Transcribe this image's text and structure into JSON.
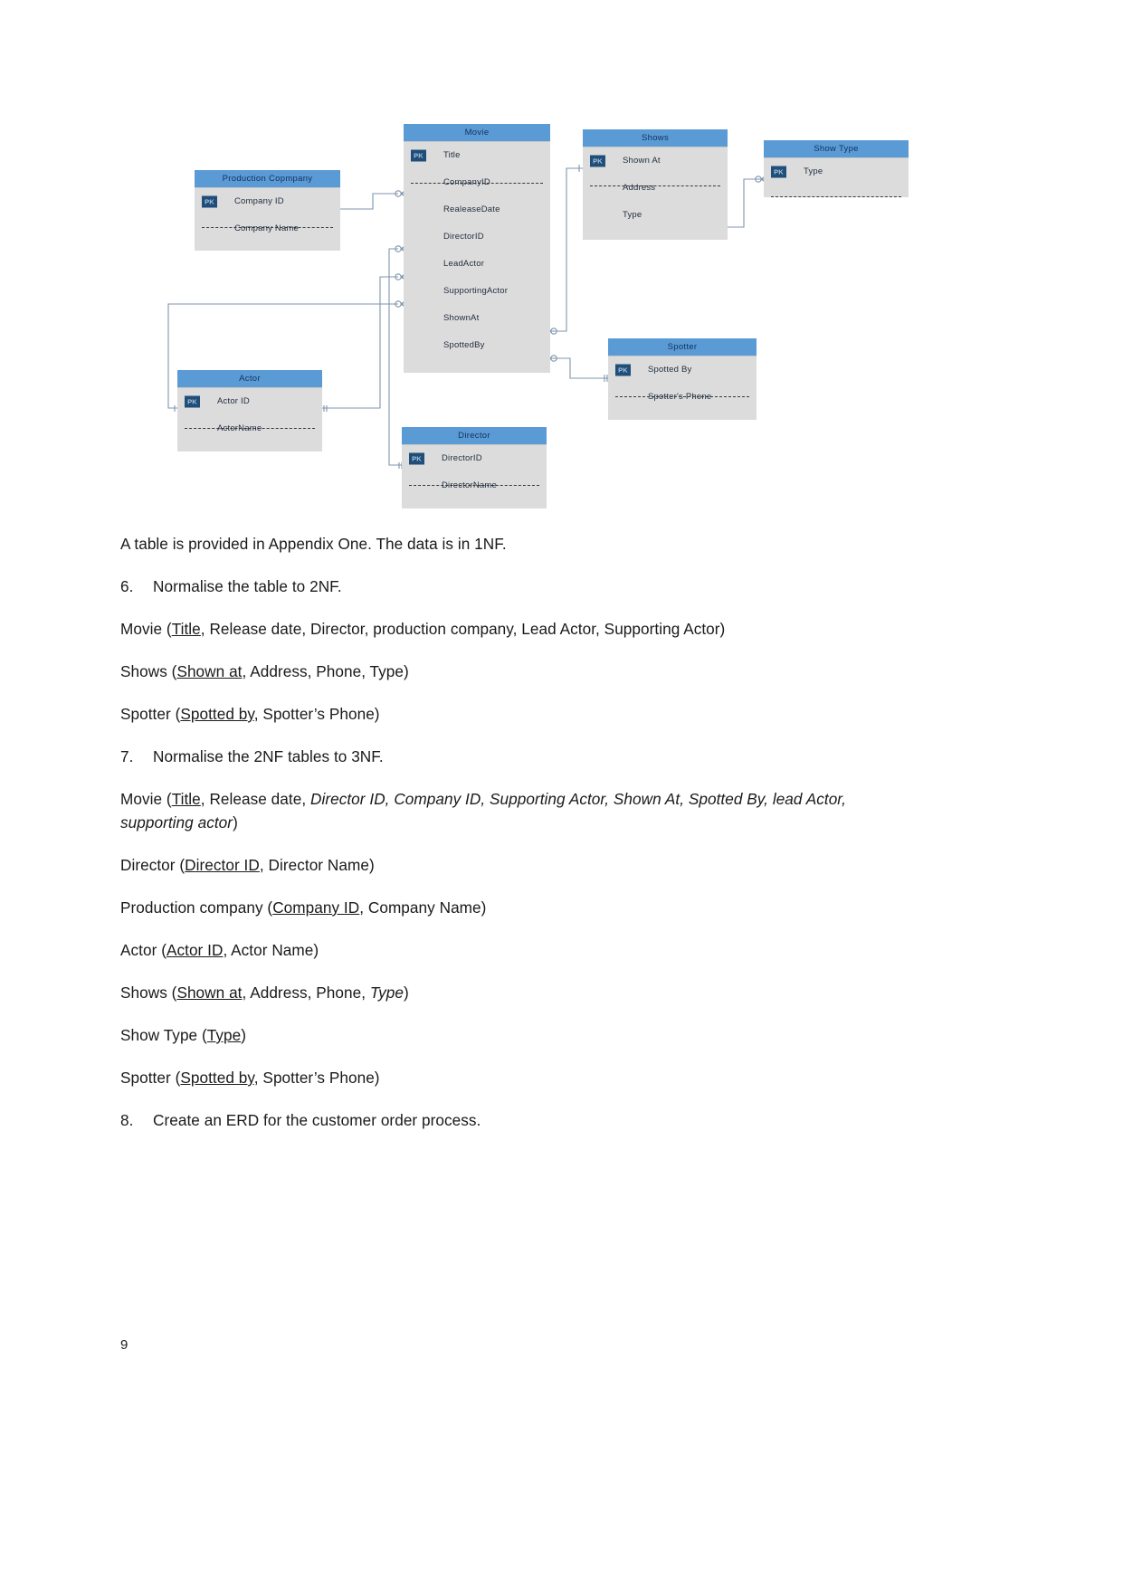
{
  "diagram": {
    "entities": [
      {
        "id": "production-company",
        "title": "Production Copmpany",
        "attributes": [
          {
            "name": "Company ID",
            "pk": true
          },
          {
            "name": "Company Name",
            "pk": false
          }
        ]
      },
      {
        "id": "movie",
        "title": "Movie",
        "attributes": [
          {
            "name": "Title",
            "pk": true
          },
          {
            "name": "CompanyID",
            "pk": false
          },
          {
            "name": "RealeaseDate",
            "pk": false
          },
          {
            "name": "DirectorID",
            "pk": false
          },
          {
            "name": "LeadActor",
            "pk": false
          },
          {
            "name": "SupportingActor",
            "pk": false
          },
          {
            "name": "ShownAt",
            "pk": false
          },
          {
            "name": "SpottedBy",
            "pk": false
          }
        ]
      },
      {
        "id": "shows",
        "title": "Shows",
        "attributes": [
          {
            "name": "Shown At",
            "pk": true
          },
          {
            "name": "Address",
            "pk": false
          },
          {
            "name": "Type",
            "pk": false
          }
        ]
      },
      {
        "id": "show-type",
        "title": "Show Type",
        "attributes": [
          {
            "name": "Type",
            "pk": true
          }
        ]
      },
      {
        "id": "actor",
        "title": "Actor",
        "attributes": [
          {
            "name": "Actor ID",
            "pk": true
          },
          {
            "name": "ActorName",
            "pk": false
          }
        ]
      },
      {
        "id": "spotter",
        "title": "Spotter",
        "attributes": [
          {
            "name": "Spotted By",
            "pk": true
          },
          {
            "name": "Spotter's Phone",
            "pk": false
          }
        ]
      },
      {
        "id": "director",
        "title": "Director",
        "attributes": [
          {
            "name": "DirectorID",
            "pk": true
          },
          {
            "name": "DirectorName",
            "pk": false
          }
        ]
      }
    ],
    "pk_label": "PK",
    "colors": {
      "header": "#5b9bd5",
      "body": "#dcdcdc",
      "pk_badge": "#1f4e79",
      "connector": "#7f95ac"
    }
  },
  "body": {
    "intro": "A table is provided in Appendix One. The data is in 1NF.",
    "q6": {
      "number": "6.",
      "text": "Normalise the table to 2NF."
    },
    "q6_movie": {
      "prefix": "Movie (",
      "key": "Title",
      "rest": ", Release date, Director, production company, Lead Actor, Supporting Actor)"
    },
    "q6_shows": {
      "prefix": "Shows (",
      "key": "Shown at",
      "rest": ", Address, Phone, Type)"
    },
    "q6_spotter": {
      "prefix": "Spotter (",
      "key": "Spotted by",
      "rest": ", Spotter’s Phone)"
    },
    "q7": {
      "number": "7.",
      "text": "Normalise the 2NF tables to 3NF."
    },
    "q7_movie": {
      "prefix": "Movie (",
      "key": "Title",
      "mid": ", Release date, ",
      "italic": "Director ID, Company ID, Supporting Actor, Shown At, Spotted By, lead Actor, supporting actor",
      "suffix": ")"
    },
    "q7_director": {
      "prefix": "Director (",
      "key": "Director ID",
      "rest": ", Director Name)"
    },
    "q7_production": {
      "prefix": "Production company (",
      "key": "Company ID",
      "rest": ", Company Name)"
    },
    "q7_actor": {
      "prefix": "Actor (",
      "key": "Actor ID",
      "rest": ", Actor Name)"
    },
    "q7_shows": {
      "prefix": "Shows (",
      "key": "Shown at",
      "mid": ", Address, Phone, ",
      "italic": "Type",
      "suffix": ")"
    },
    "q7_showtype": {
      "prefix": "Show Type (",
      "key": "Type",
      "rest": ")"
    },
    "q7_spotter": {
      "prefix": "Spotter (",
      "key": "Spotted by",
      "rest": ", Spotter’s Phone)"
    },
    "q8": {
      "number": "8.",
      "text": "Create an ERD for the customer order process."
    }
  },
  "footer": {
    "page_number": "9"
  }
}
